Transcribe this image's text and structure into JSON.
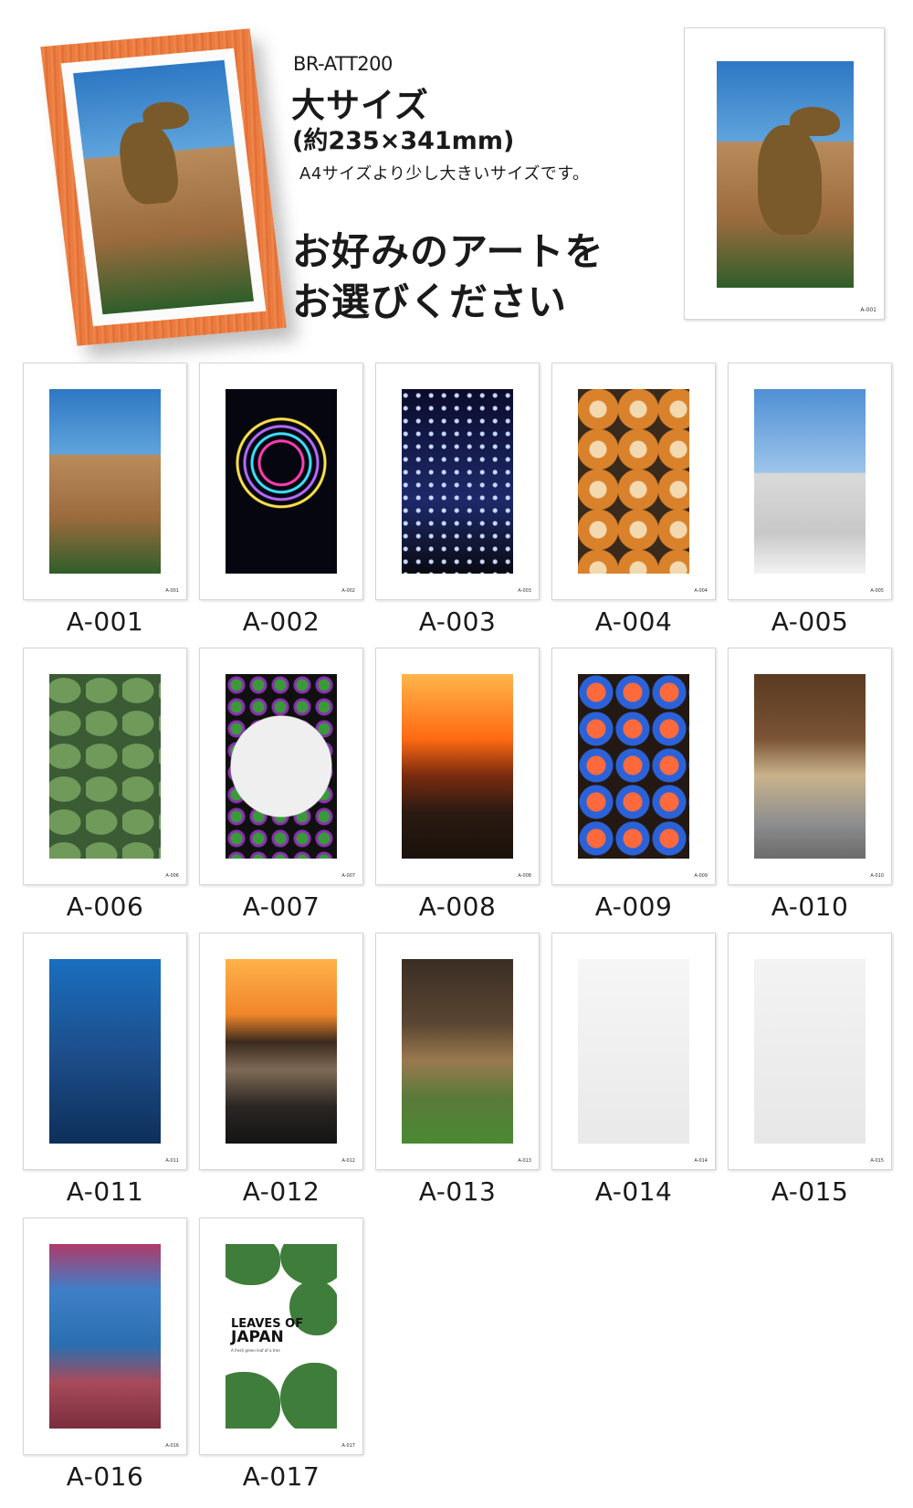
{
  "header": {
    "product_code": "BR-ATT200",
    "size_title": "大サイズ",
    "size_dims": "(約235×341mm)",
    "size_note": "A4サイズより少し大きいサイズです。",
    "choose_line1": "お好みのアートを",
    "choose_line2": "お選びください",
    "frame_color": "#e8743a",
    "preview_code": "A-001"
  },
  "gallery": [
    {
      "code": "A-001",
      "mini": "A-001",
      "icon": "tyrannosaurus-statue-photo"
    },
    {
      "code": "A-002",
      "mini": "A-002",
      "icon": "ferris-wheel-night-photo"
    },
    {
      "code": "A-003",
      "mini": "A-003",
      "icon": "illuminated-trees-photo"
    },
    {
      "code": "A-004",
      "mini": "A-004",
      "icon": "donuts-photo"
    },
    {
      "code": "A-005",
      "mini": "A-005",
      "icon": "clock-tower-pine-photo"
    },
    {
      "code": "A-006",
      "mini": "A-006",
      "icon": "water-lilies-photo"
    },
    {
      "code": "A-007",
      "mini": "A-007",
      "icon": "salad-plate-photo"
    },
    {
      "code": "A-008",
      "mini": "A-008",
      "icon": "bonfire-photo"
    },
    {
      "code": "A-009",
      "mini": "A-009",
      "icon": "mosaic-lamps-photo"
    },
    {
      "code": "A-010",
      "mini": "A-010",
      "icon": "japanese-corridor-photo"
    },
    {
      "code": "A-011",
      "mini": "A-011",
      "icon": "lionfish-photo"
    },
    {
      "code": "A-012",
      "mini": "A-012",
      "icon": "sunset-coast-photo"
    },
    {
      "code": "A-013",
      "mini": "A-013",
      "icon": "deer-photo"
    },
    {
      "code": "A-014",
      "mini": "A-014",
      "icon": "kitten-photo"
    },
    {
      "code": "A-015",
      "mini": "A-015",
      "icon": "puppy-photo"
    },
    {
      "code": "A-016",
      "mini": "A-016",
      "icon": "sea-turtle-photo"
    },
    {
      "code": "A-017",
      "mini": "A-017",
      "icon": "monstera-leaves-art"
    }
  ],
  "leaves_art": {
    "title_line1": "LEAVES OF",
    "title_line2": "JAPAN",
    "subtitle": "A fresh green leaf of a tree"
  }
}
